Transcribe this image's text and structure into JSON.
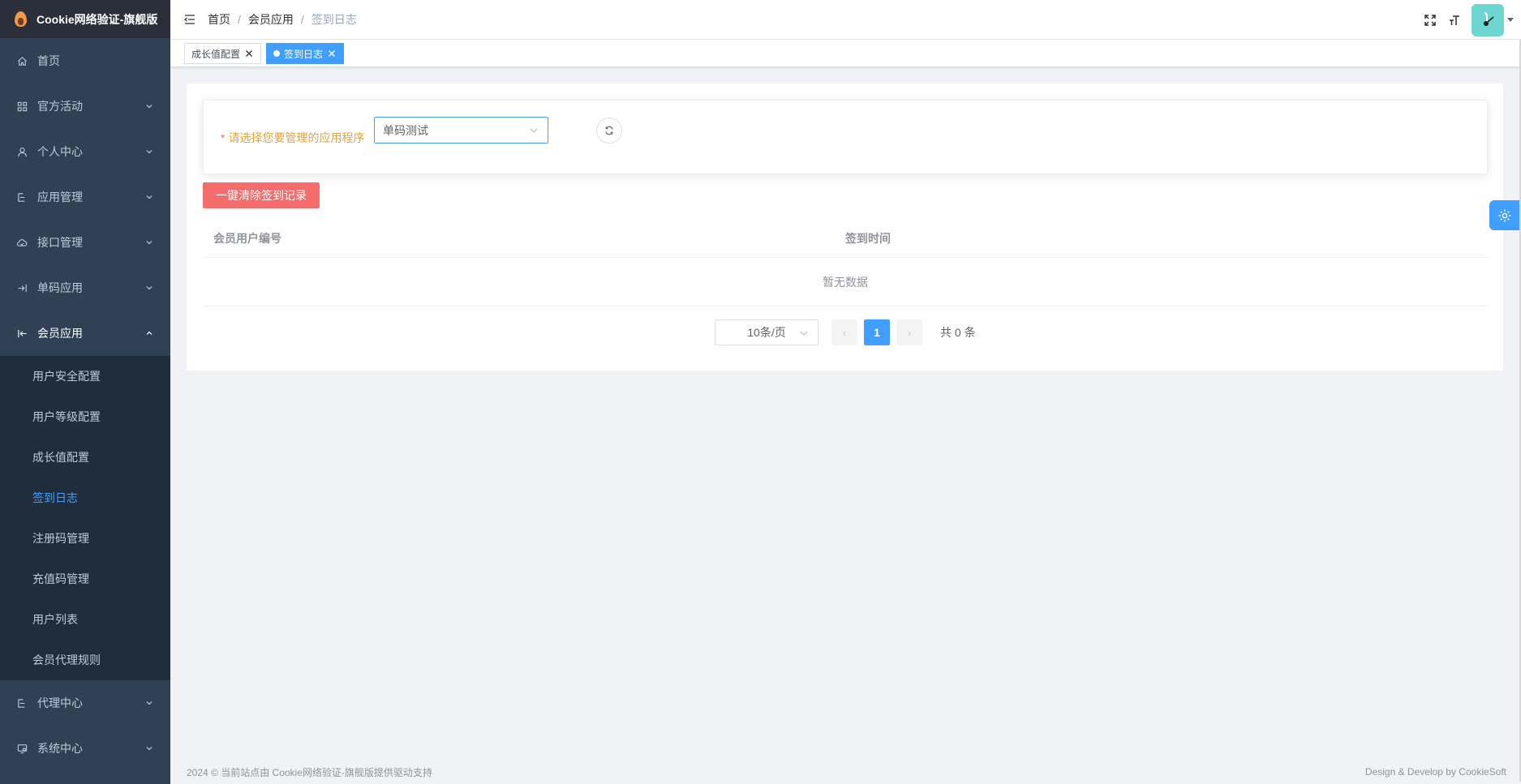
{
  "app": {
    "title": "Cookie网络验证-旗舰版"
  },
  "sidebar": {
    "items": [
      {
        "label": "首页",
        "icon": "home-icon",
        "expandable": false
      },
      {
        "label": "官方活动",
        "icon": "grid-icon",
        "expandable": true
      },
      {
        "label": "个人中心",
        "icon": "user-icon",
        "expandable": true
      },
      {
        "label": "应用管理",
        "icon": "tree-icon",
        "expandable": true
      },
      {
        "label": "接口管理",
        "icon": "cloud-icon",
        "expandable": true
      },
      {
        "label": "单码应用",
        "icon": "login-icon",
        "expandable": true
      },
      {
        "label": "会员应用",
        "icon": "logout-icon",
        "expandable": true,
        "expanded": true
      }
    ],
    "submenu": [
      {
        "label": "用户安全配置"
      },
      {
        "label": "用户等级配置"
      },
      {
        "label": "成长值配置"
      },
      {
        "label": "签到日志",
        "active": true
      },
      {
        "label": "注册码管理"
      },
      {
        "label": "充值码管理"
      },
      {
        "label": "用户列表"
      },
      {
        "label": "会员代理规则"
      }
    ],
    "bottom_items": [
      {
        "label": "代理中心",
        "icon": "tree-icon"
      },
      {
        "label": "系统中心",
        "icon": "monitor-icon"
      }
    ]
  },
  "navbar": {
    "breadcrumb": [
      "首页",
      "会员应用",
      "签到日志"
    ],
    "separator": "/"
  },
  "tags": [
    {
      "label": "成长值配置",
      "active": false
    },
    {
      "label": "签到日志",
      "active": true
    }
  ],
  "form": {
    "required_mark": "*",
    "label": "请选择您要管理的应用程序",
    "select_value": "单码测试"
  },
  "actions": {
    "clear_button": "一键清除签到记录"
  },
  "table": {
    "columns": [
      "会员用户编号",
      "签到时间"
    ],
    "empty_text": "暂无数据"
  },
  "pagination": {
    "page_size": "10条/页",
    "current_page": "1",
    "prev": "‹",
    "next": "›",
    "total": "共 0 条"
  },
  "footer": {
    "left": "2024 © 当前站点由 Cookie网络验证-旗舰版提供驱动支持",
    "right": "Design & Develop by CookieSoft"
  },
  "colors": {
    "sidebar_bg": "#304156",
    "submenu_bg": "#1f2d3d",
    "accent": "#409eff",
    "danger": "#f56c6c",
    "warning": "#e6a23c"
  }
}
